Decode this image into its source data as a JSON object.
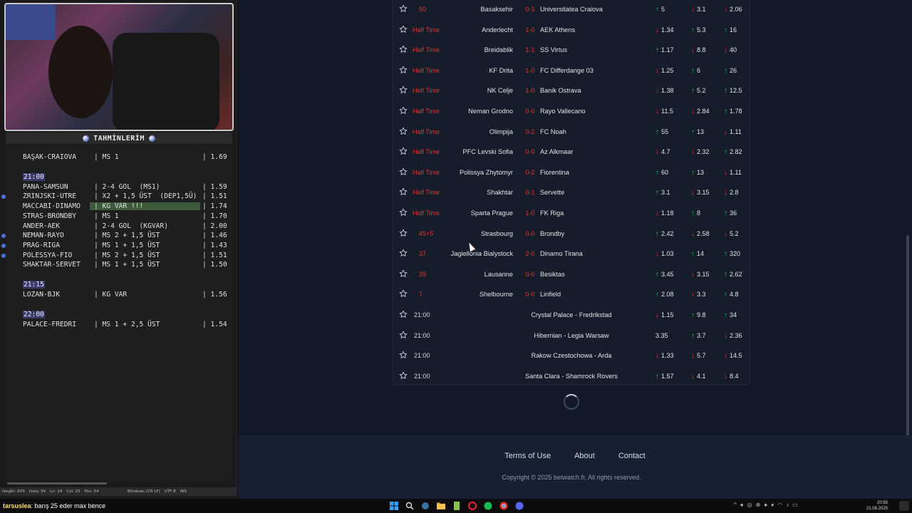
{
  "left_panel": {
    "title": "TAHMİNLERİM",
    "bet_lines": [
      {
        "type": "bet",
        "match": "BAŞAK-CRAIOVA",
        "pick": "| MS 1",
        "odd": "| 1.69",
        "dot": false,
        "highlight": false
      },
      {
        "type": "time",
        "label": "21:00"
      },
      {
        "type": "bet",
        "match": "PANA-SAMSUN",
        "pick": "| 2-4 GOL  (MS1)",
        "odd": "| 1.59",
        "dot": false,
        "highlight": false
      },
      {
        "type": "bet",
        "match": "ZRINJSKI-UTRE",
        "pick": "| X2 + 1,5 ÜST  (DEP1,5Ü)",
        "odd": "| 1.51",
        "dot": true,
        "highlight": false
      },
      {
        "type": "bet",
        "match": "MACCABI-DINAMO",
        "pick": "| KG VAR !!!",
        "odd": "| 1.74",
        "dot": false,
        "highlight": true
      },
      {
        "type": "bet",
        "match": "STRAS-BRONDBY",
        "pick": "| MS 1",
        "odd": "| 1.70",
        "dot": false,
        "highlight": false
      },
      {
        "type": "bet",
        "match": "ANDER-AEK",
        "pick": "| 2-4 GOL  (KGVAR)",
        "odd": "| 2.00",
        "dot": false,
        "highlight": false
      },
      {
        "type": "bet",
        "match": "NEMAN-RAYO",
        "pick": "| MS 2 + 1,5 ÜST",
        "odd": "| 1.46",
        "dot": true,
        "highlight": false
      },
      {
        "type": "bet",
        "match": "PRAG-RIGA",
        "pick": "| MS 1 + 1,5 ÜST",
        "odd": "| 1.43",
        "dot": true,
        "highlight": false
      },
      {
        "type": "bet",
        "match": "POLESSYA-FIO",
        "pick": "| MS 2 + 1,5 ÜST",
        "odd": "| 1.51",
        "dot": true,
        "highlight": false
      },
      {
        "type": "bet",
        "match": "SHAKTAR-SERVET",
        "pick": "| MS 1 + 1,5 ÜST",
        "odd": "| 1.50",
        "dot": false,
        "highlight": false
      },
      {
        "type": "time",
        "label": "21:15"
      },
      {
        "type": "bet",
        "match": "LOZAN-BJK",
        "pick": "| KG VAR",
        "odd": "| 1.56",
        "dot": false,
        "highlight": false
      },
      {
        "type": "time",
        "label": "22:00"
      },
      {
        "type": "bet",
        "match": "PALACE-FREDRI",
        "pick": "| MS 1 + 2,5 ÜST",
        "odd": "| 1.54",
        "dot": false,
        "highlight": false
      }
    ],
    "editor_status": [
      "length: 603",
      "lines: 34",
      "Ln: 14",
      "Col: 25",
      "Pos: 54",
      "Windows (CR LF)",
      "UTF-8",
      "INS"
    ]
  },
  "matches": [
    {
      "status": "50",
      "status_kind": "live",
      "home": "Basaksehir",
      "score": "0-1",
      "away": "Universitatea Craiova",
      "odds": [
        {
          "v": "5",
          "d": "up"
        },
        {
          "v": "3.1",
          "d": "down"
        },
        {
          "v": "2.06",
          "d": "down"
        }
      ]
    },
    {
      "status": "Half Time",
      "status_kind": "live",
      "home": "Anderlecht",
      "score": "1-0",
      "away": "AEK Athens",
      "odds": [
        {
          "v": "1.34",
          "d": "down"
        },
        {
          "v": "5.3",
          "d": "up"
        },
        {
          "v": "16",
          "d": "up"
        }
      ]
    },
    {
      "status": "Half Time",
      "status_kind": "live",
      "home": "Breidablik",
      "score": "1-1",
      "away": "SS Virtus",
      "odds": [
        {
          "v": "1.17",
          "d": "up"
        },
        {
          "v": "8.8",
          "d": "down"
        },
        {
          "v": "40",
          "d": "down"
        }
      ]
    },
    {
      "status": "Half Time",
      "status_kind": "live",
      "home": "KF Drita",
      "score": "1-0",
      "away": "FC Differdange 03",
      "odds": [
        {
          "v": "1.25",
          "d": "down"
        },
        {
          "v": "6",
          "d": "up"
        },
        {
          "v": "26",
          "d": "up"
        }
      ]
    },
    {
      "status": "Half Time",
      "status_kind": "live",
      "home": "NK Celje",
      "score": "1-0",
      "away": "Banik Ostrava",
      "odds": [
        {
          "v": "1.38",
          "d": "down"
        },
        {
          "v": "5.2",
          "d": "up"
        },
        {
          "v": "12.5",
          "d": "up"
        }
      ]
    },
    {
      "status": "Half Time",
      "status_kind": "live",
      "home": "Neman Grodno",
      "score": "0-0",
      "away": "Rayo Vallecano",
      "odds": [
        {
          "v": "11.5",
          "d": "down"
        },
        {
          "v": "2.84",
          "d": "down"
        },
        {
          "v": "1.78",
          "d": "up"
        }
      ]
    },
    {
      "status": "Half Time",
      "status_kind": "live",
      "home": "Olimpija",
      "score": "0-2",
      "away": "FC Noah",
      "odds": [
        {
          "v": "55",
          "d": "up"
        },
        {
          "v": "13",
          "d": "up"
        },
        {
          "v": "1.11",
          "d": "down"
        }
      ]
    },
    {
      "status": "Half Time",
      "status_kind": "live",
      "home": "PFC Levski Sofia",
      "score": "0-0",
      "away": "Az Alkmaar",
      "odds": [
        {
          "v": "4.7",
          "d": "down"
        },
        {
          "v": "2.32",
          "d": "down"
        },
        {
          "v": "2.82",
          "d": "up"
        }
      ]
    },
    {
      "status": "Half Time",
      "status_kind": "live",
      "home": "Polissya Zhytomyr",
      "score": "0-2",
      "away": "Fiorentina",
      "odds": [
        {
          "v": "60",
          "d": "up"
        },
        {
          "v": "13",
          "d": "up"
        },
        {
          "v": "1.11",
          "d": "down"
        }
      ]
    },
    {
      "status": "Half Time",
      "status_kind": "live",
      "home": "Shakhtar",
      "score": "0-1",
      "away": "Servette",
      "odds": [
        {
          "v": "3.1",
          "d": "up"
        },
        {
          "v": "3.15",
          "d": "down"
        },
        {
          "v": "2.8",
          "d": "down"
        }
      ]
    },
    {
      "status": "Half Time",
      "status_kind": "live",
      "home": "Sparta Prague",
      "score": "1-0",
      "away": "FK Riga",
      "odds": [
        {
          "v": "1.18",
          "d": "down"
        },
        {
          "v": "8",
          "d": "up"
        },
        {
          "v": "36",
          "d": "up"
        }
      ]
    },
    {
      "status": "45+5",
      "status_kind": "live",
      "home": "Strasbourg",
      "score": "0-0",
      "away": "Brondby",
      "odds": [
        {
          "v": "2.42",
          "d": "up"
        },
        {
          "v": "2.58",
          "d": "down"
        },
        {
          "v": "5.2",
          "d": "down"
        }
      ]
    },
    {
      "status": "37",
      "status_kind": "live",
      "home": "Jagiellonia Bialystock",
      "score": "2-0",
      "away": "Dinamo Tirana",
      "odds": [
        {
          "v": "1.03",
          "d": "down"
        },
        {
          "v": "14",
          "d": "up"
        },
        {
          "v": "320",
          "d": "up"
        }
      ]
    },
    {
      "status": "39",
      "status_kind": "live",
      "home": "Lausanne",
      "score": "0-0",
      "away": "Besiktas",
      "odds": [
        {
          "v": "3.45",
          "d": "up"
        },
        {
          "v": "3.15",
          "d": "down"
        },
        {
          "v": "2.62",
          "d": "up"
        }
      ]
    },
    {
      "status": "7",
      "status_kind": "live",
      "home": "Shelbourne",
      "score": "0-0",
      "away": "Linfield",
      "odds": [
        {
          "v": "2.08",
          "d": "up"
        },
        {
          "v": "3.3",
          "d": "down"
        },
        {
          "v": "4.8",
          "d": "up"
        }
      ]
    },
    {
      "status": "21:00",
      "status_kind": "time",
      "fixture": "Crystal Palace - Fredrikstad",
      "odds": [
        {
          "v": "1.15",
          "d": "down"
        },
        {
          "v": "9.8",
          "d": "up"
        },
        {
          "v": "34",
          "d": "up"
        }
      ]
    },
    {
      "status": "21:00",
      "status_kind": "time",
      "fixture": "Hibernian - Legia Warsaw",
      "odds": [
        {
          "v": "3.35",
          "d": "none"
        },
        {
          "v": "3.7",
          "d": "up"
        },
        {
          "v": "2.36",
          "d": "down"
        }
      ]
    },
    {
      "status": "21:00",
      "status_kind": "time",
      "fixture": "Rakow Czestochowa - Arda",
      "odds": [
        {
          "v": "1.33",
          "d": "down"
        },
        {
          "v": "5.7",
          "d": "down"
        },
        {
          "v": "14.5",
          "d": "down"
        }
      ]
    },
    {
      "status": "21:00",
      "status_kind": "time",
      "fixture": "Santa Clara - Shamrock Rovers",
      "odds": [
        {
          "v": "1.57",
          "d": "up"
        },
        {
          "v": "4.1",
          "d": "down"
        },
        {
          "v": "8.4",
          "d": "down"
        }
      ]
    }
  ],
  "footer": {
    "links": [
      "Terms of Use",
      "About",
      "Contact"
    ],
    "copyright": "Copyright © 2025 betwatch.fr, All rights reserved."
  },
  "chat": {
    "user": "tarsuslea",
    "message": ": barış 25 eder max bence"
  },
  "taskbar": {
    "icons": [
      "windows-start-icon",
      "search-icon",
      "steam-icon",
      "folder-icon",
      "notepad-icon",
      "opera-icon",
      "spotify-icon",
      "chrome-icon",
      "discord-icon"
    ],
    "clock_time": "20:55",
    "clock_date": "21.08.2025"
  },
  "colors": {
    "live": "#e0352b",
    "up": "#27c24c",
    "down": "#e0352b",
    "background": "#111827",
    "card": "#151d2b"
  }
}
